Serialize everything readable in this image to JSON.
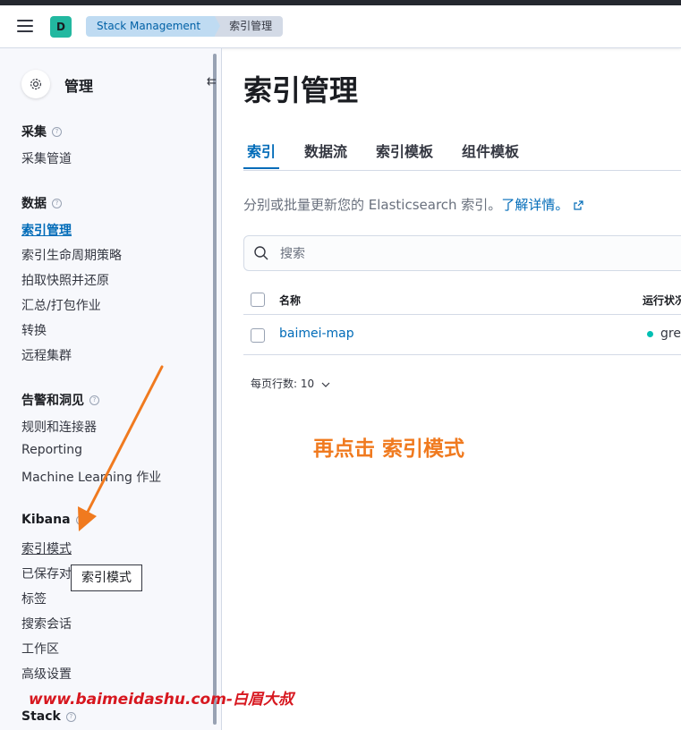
{
  "header": {
    "space_initial": "D",
    "breadcrumbs": [
      "Stack Management",
      "索引管理"
    ]
  },
  "sidebar": {
    "title": "管理",
    "groups": [
      {
        "title": "采集",
        "items": [
          "采集管道"
        ]
      },
      {
        "title": "数据",
        "items": [
          "索引管理",
          "索引生命周期策略",
          "拍取快照并还原",
          "汇总/打包作业",
          "转换",
          "远程集群"
        ]
      },
      {
        "title": "告警和洞见",
        "items": [
          "规则和连接器",
          "Reporting",
          "Machine Learning 作业"
        ]
      },
      {
        "title": "Kibana",
        "items": [
          "索引模式",
          "已保存对",
          "标签",
          "搜索会话",
          "工作区",
          "高级设置"
        ]
      },
      {
        "title": "Stack",
        "items": []
      }
    ],
    "active_item": "索引管理",
    "tooltip": "索引模式"
  },
  "main": {
    "title": "索引管理",
    "tabs": [
      "索引",
      "数据流",
      "索引模板",
      "组件模板"
    ],
    "active_tab": "索引",
    "description_text": "分别或批量更新您的 Elasticsearch 索引。",
    "description_link": "了解详情。",
    "search_placeholder": "搜索",
    "table": {
      "columns": [
        "名称",
        "运行状况"
      ],
      "rows": [
        {
          "name": "baimei-map",
          "health": "green"
        }
      ]
    },
    "rows_per_page": "每页行数: 10"
  },
  "annotation": "再点击 索引模式",
  "watermark": "www.baimeidashu.com-白眉大叔",
  "colors": {
    "accent": "#006bb8",
    "annotation": "#f07a1f",
    "health_green": "#00bfb3",
    "watermark": "#d7171f"
  }
}
